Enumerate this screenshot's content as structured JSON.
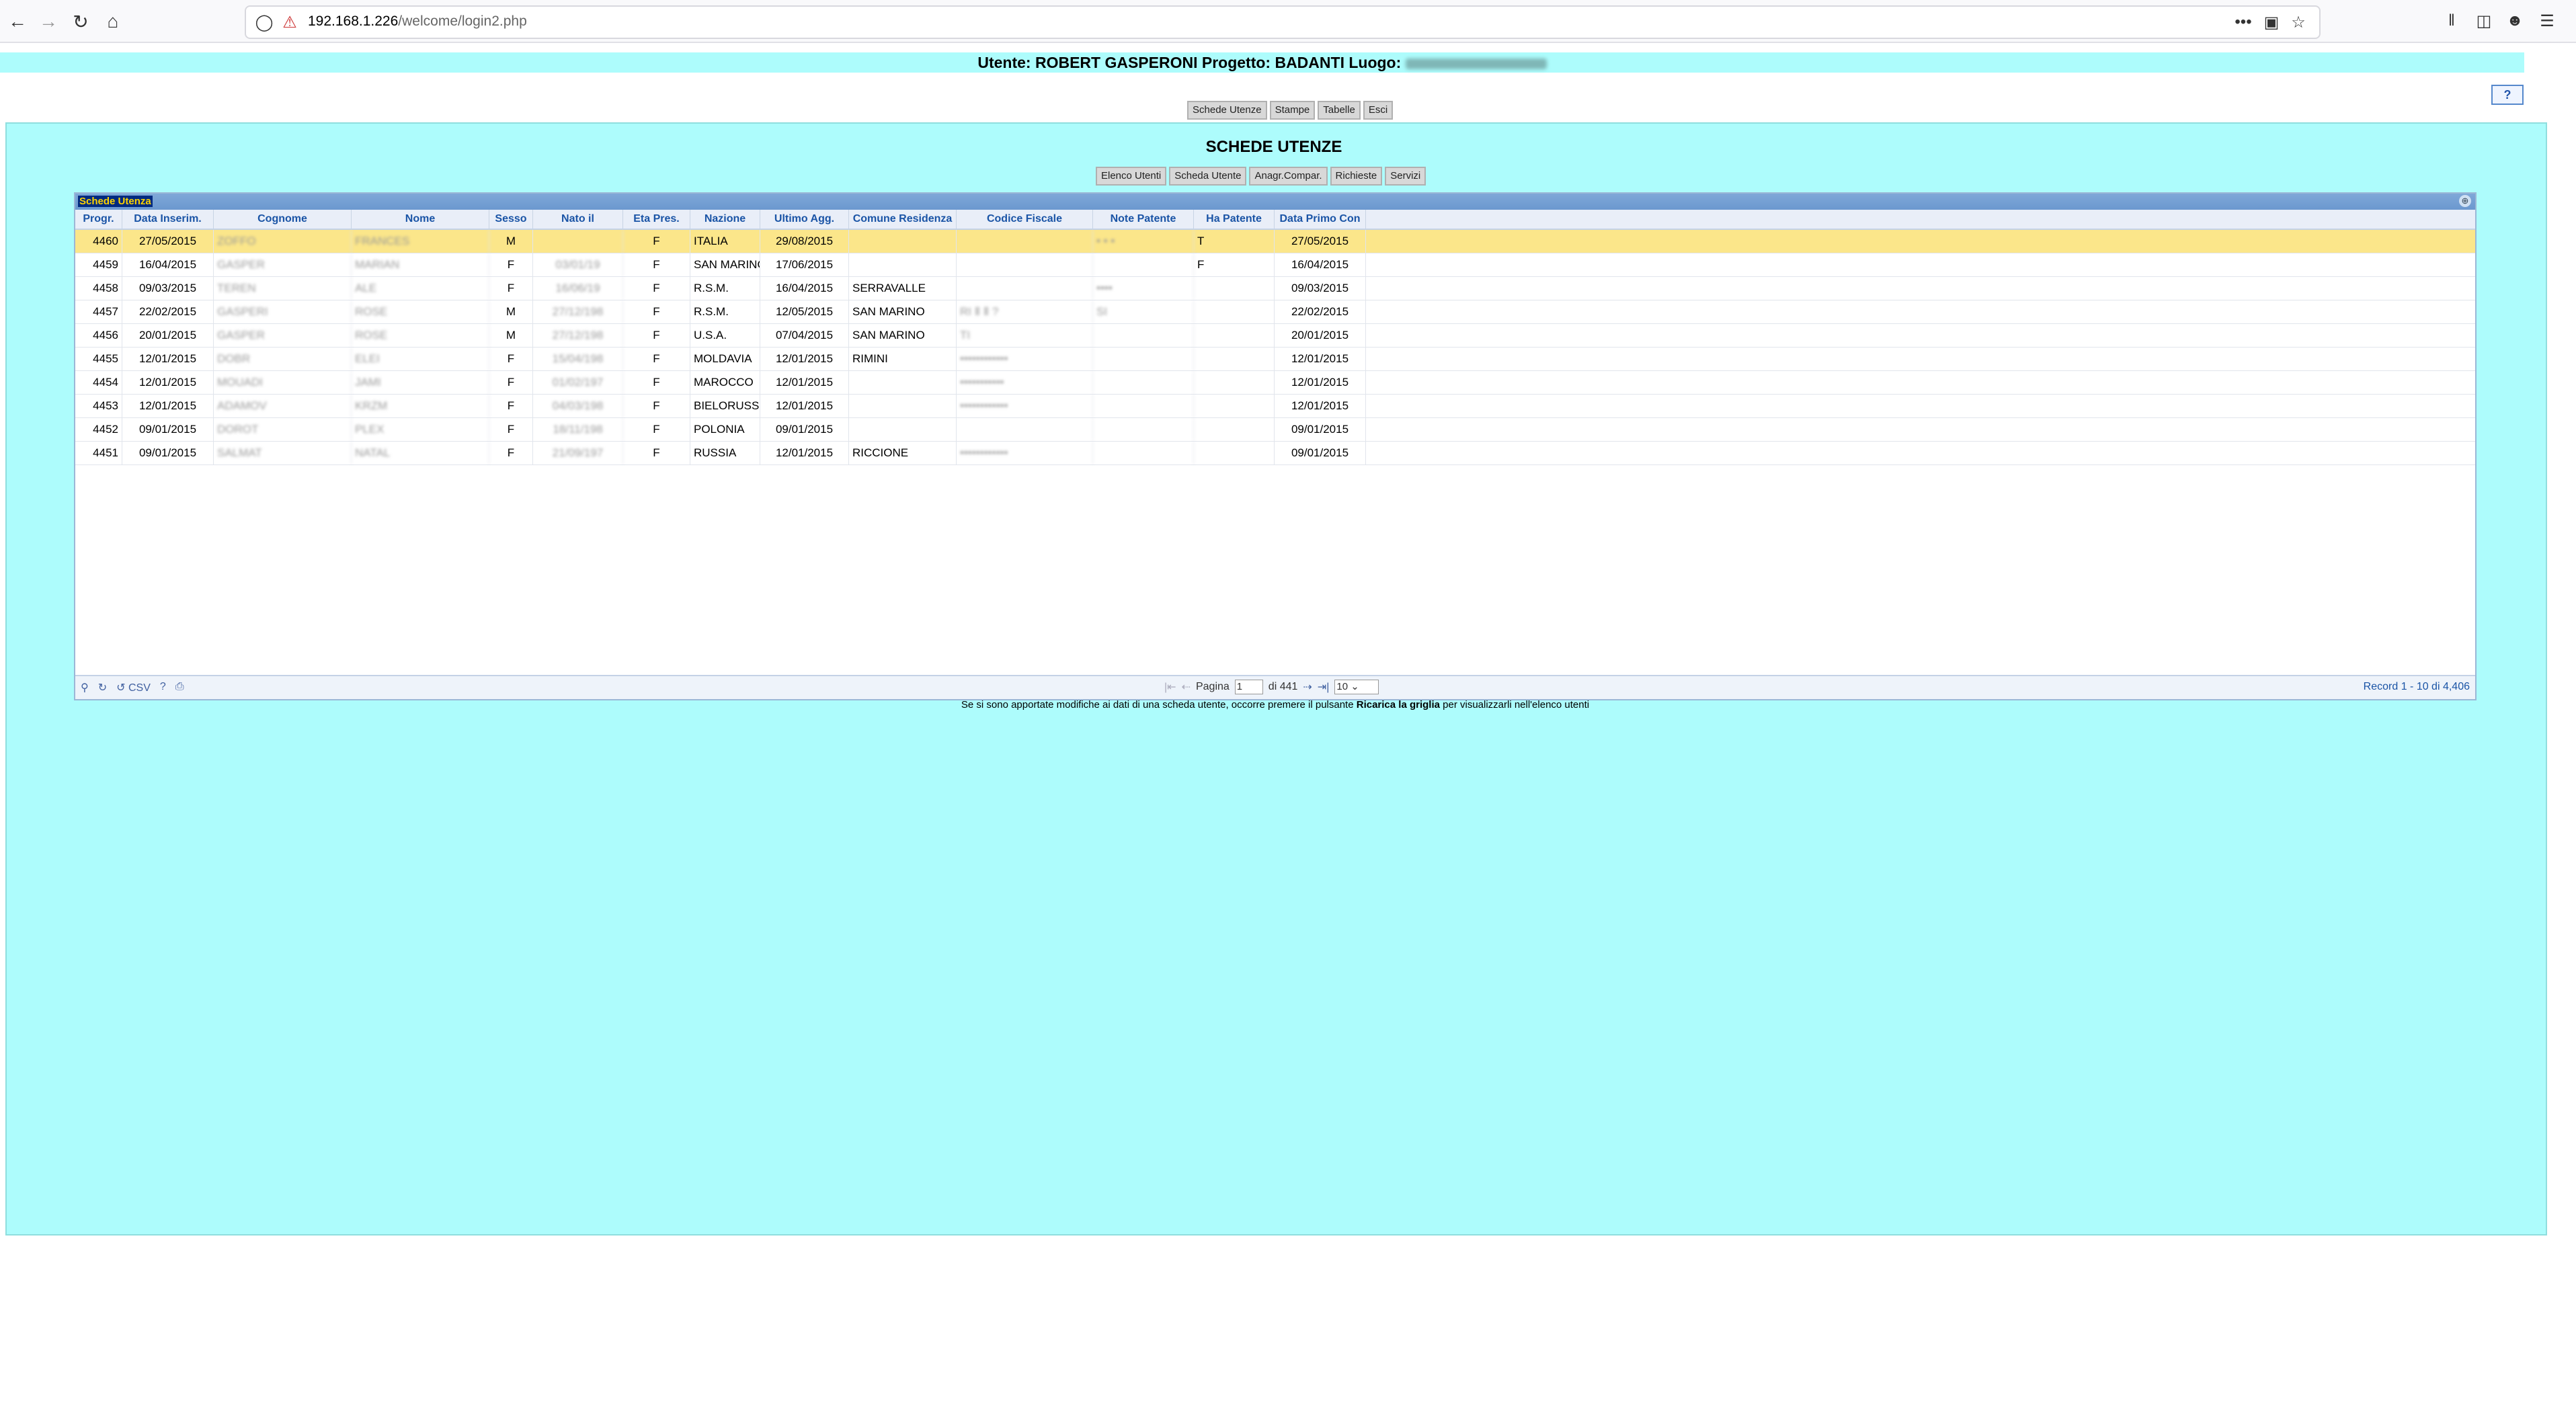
{
  "browser": {
    "url_host": "192.168.1.226",
    "url_path": "/welcome/login2.php",
    "more_label": "•••"
  },
  "banner": {
    "prefix": "Utente: ROBERT GASPERONI Progetto: BADANTI Luogo:"
  },
  "topmenu": [
    "Schede Utenze",
    "Stampe",
    "Tabelle",
    "Esci"
  ],
  "help_label": "?",
  "page_title": "SCHEDE UTENZE",
  "submenu": [
    "Elenco Utenti",
    "Scheda Utente",
    "Anagr.Compar.",
    "Richieste",
    "Servizi"
  ],
  "grid": {
    "caption": "Schede Utenza",
    "columns": [
      "Progr.",
      "Data Inserim.",
      "Cognome",
      "Nome",
      "Sesso",
      "Nato il",
      "Eta Pres.",
      "Nazione",
      "Ultimo Agg.",
      "Comune Residenza",
      "Codice Fiscale",
      "Note Patente",
      "Ha Patente",
      "Data Primo Con"
    ],
    "rows": [
      [
        "4460",
        "27/05/2015",
        "ZOFFO",
        "FRANCES",
        "M",
        "",
        "F",
        "ITALIA",
        "29/08/2015",
        "",
        "",
        "• • •",
        "T",
        "27/05/2015"
      ],
      [
        "4459",
        "16/04/2015",
        "GASPER",
        "MARIAN",
        "F",
        "03/01/19",
        "F",
        "SAN MARINO",
        "17/06/2015",
        "",
        "",
        "",
        "F",
        "16/04/2015"
      ],
      [
        "4458",
        "09/03/2015",
        "TEREN",
        "ALE",
        "F",
        "16/06/19",
        "F",
        "R.S.M.",
        "16/04/2015",
        "SERRAVALLE",
        "",
        "••••",
        "",
        "09/03/2015"
      ],
      [
        "4457",
        "22/02/2015",
        "GASPERI",
        "ROSE",
        "M",
        "27/12/198",
        "F",
        "R.S.M.",
        "12/05/2015",
        "SAN MARINO",
        "RI Ⅱ Ⅱ ?",
        "SI",
        "",
        "22/02/2015"
      ],
      [
        "4456",
        "20/01/2015",
        "GASPER",
        "ROSE",
        "M",
        "27/12/198",
        "F",
        "U.S.A.",
        "07/04/2015",
        "SAN MARINO",
        "TI",
        "",
        "",
        "20/01/2015"
      ],
      [
        "4455",
        "12/01/2015",
        "DOBR",
        "ELEI",
        "F",
        "15/04/198",
        "F",
        "MOLDAVIA",
        "12/01/2015",
        "RIMINI",
        "••••••••••••",
        "",
        "",
        "12/01/2015"
      ],
      [
        "4454",
        "12/01/2015",
        "MOUADI",
        "JAMI",
        "F",
        "01/02/197",
        "F",
        "MAROCCO",
        "12/01/2015",
        "",
        "•••••••••••",
        "",
        "",
        "12/01/2015"
      ],
      [
        "4453",
        "12/01/2015",
        "ADAMOV",
        "KRZM",
        "F",
        "04/03/198",
        "F",
        "BIELORUSSIA",
        "12/01/2015",
        "",
        "••••••••••••",
        "",
        "",
        "12/01/2015"
      ],
      [
        "4452",
        "09/01/2015",
        "DOROT",
        "PLEX",
        "F",
        "18/11/198",
        "F",
        "POLONIA",
        "09/01/2015",
        "",
        "",
        "",
        "",
        "09/01/2015"
      ],
      [
        "4451",
        "09/01/2015",
        "SALMAT",
        "NATAL",
        "F",
        "21/09/197",
        "F",
        "RUSSIA",
        "12/01/2015",
        "RICCIONE",
        "••••••••••••",
        "",
        "",
        "09/01/2015"
      ]
    ],
    "selected_row": 0,
    "pager": {
      "csv": "CSV",
      "help": "?",
      "page_label": "Pagina",
      "page_value": "1",
      "of_label": "di 441",
      "rows_per_page": "10",
      "record_info": "Record 1 - 10 di 4,406"
    }
  },
  "note": {
    "before": "Se si sono apportate modifiche ai dati di una scheda utente, occorre premere il pulsante ",
    "bold": "Ricarica la griglia",
    "after": " per visualizzarli nell'elenco utenti"
  }
}
